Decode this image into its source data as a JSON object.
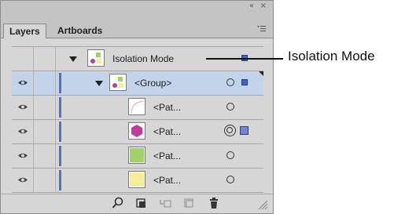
{
  "panel": {
    "collapse_icon": "«",
    "close_icon": "×",
    "tabs": [
      {
        "label": "Layers",
        "active": true
      },
      {
        "label": "Artboards",
        "active": false
      }
    ],
    "menu_icon": "panel-menu-icon"
  },
  "layers": [
    {
      "label": "Isolation Mode",
      "type": "isolation-header",
      "thumb": "isolation-thumb"
    },
    {
      "label": "<Group>",
      "type": "group",
      "selected": true,
      "thumb": "group-thumb"
    },
    {
      "label": "<Pat...",
      "type": "path",
      "thumb": "arc-path-thumb"
    },
    {
      "label": "<Pat...",
      "type": "path",
      "thumb": "hexagon-thumb",
      "selected_target": true
    },
    {
      "label": "<Pat...",
      "type": "path",
      "thumb": "green-rect-thumb"
    },
    {
      "label": "<Pat...",
      "type": "path",
      "thumb": "yellow-rect-thumb"
    }
  ],
  "toolbar": {
    "icons": [
      "locate-object-icon",
      "make-clipping-mask-icon",
      "create-sublayer-icon",
      "create-new-layer-icon",
      "delete-icon"
    ]
  },
  "callout": {
    "label": "Isolation Mode"
  },
  "colors": {
    "layer_color": "#4b74c9",
    "selection_fill": "#c3d3ea",
    "hexagon": "#c03aa0",
    "green": "#a2d06a",
    "yellow": "#f4ee9a"
  }
}
